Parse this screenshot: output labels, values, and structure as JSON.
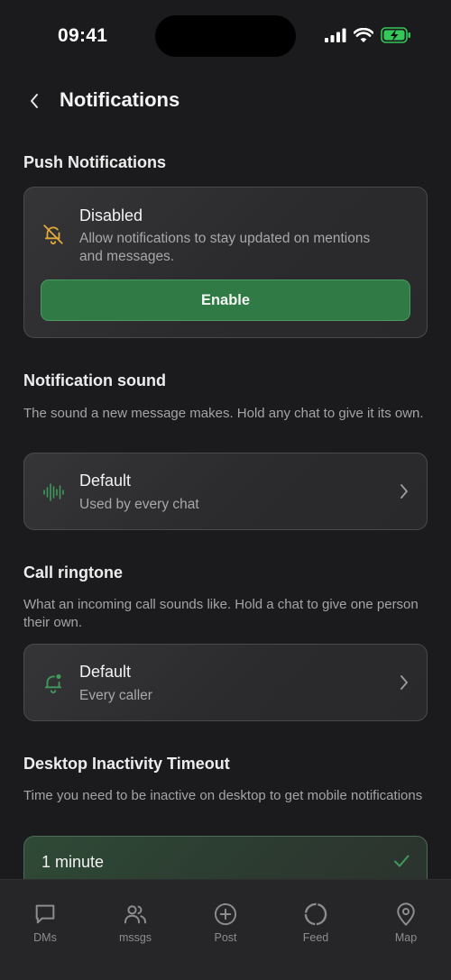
{
  "status_bar": {
    "time": "09:41"
  },
  "header": {
    "title": "Notifications"
  },
  "push": {
    "section_title": "Push Notifications",
    "status_title": "Disabled",
    "status_desc": "Allow notifications to stay updated on mentions and messages.",
    "enable_label": "Enable"
  },
  "sound": {
    "section_title": "Notification sound",
    "section_desc": "The sound a new message makes. Hold any chat to give it its own.",
    "value": "Default",
    "sub": "Used by every chat"
  },
  "ringtone": {
    "section_title": "Call ringtone",
    "section_desc": "What an incoming call sounds like. Hold a chat to give one person their own.",
    "value": "Default",
    "sub": "Every caller"
  },
  "desktop_timeout": {
    "section_title": "Desktop Inactivity Timeout",
    "section_desc": "Time you need to be inactive on desktop to get mobile notifications",
    "selected_option": "1 minute"
  },
  "tabs": [
    {
      "label": "DMs",
      "icon": "chat-bubble-icon"
    },
    {
      "label": "mssgs",
      "icon": "users-icon"
    },
    {
      "label": "Post",
      "icon": "plus-circle-icon"
    },
    {
      "label": "Feed",
      "icon": "circle-icon"
    },
    {
      "label": "Map",
      "icon": "map-pin-icon"
    }
  ],
  "colors": {
    "accent_green": "#2f7a45",
    "warning_icon": "#e0a93a",
    "background": "#1b1b1d"
  }
}
